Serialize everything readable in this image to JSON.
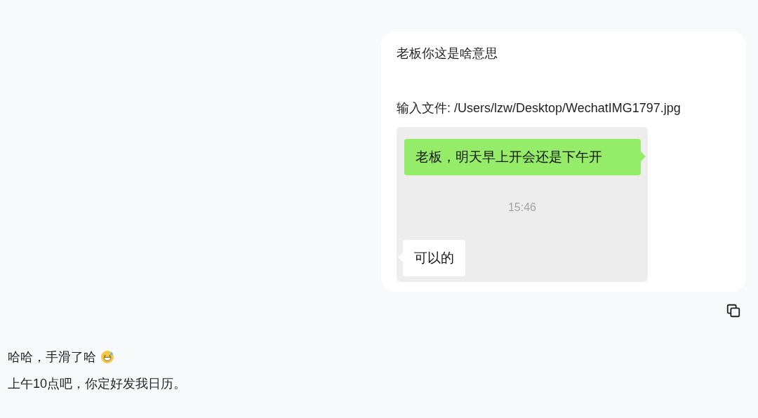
{
  "user_message": {
    "text": "老板你这是啥意思",
    "attachment_line": "输入文件: /Users/lzw/Desktop/WechatIMG1797.jpg",
    "attached_screenshot": {
      "messages": [
        {
          "kind": "sent",
          "text": "老板，明天早上开会还是下午开"
        },
        {
          "kind": "time",
          "text": "15:46"
        },
        {
          "kind": "received",
          "text": "可以的"
        }
      ]
    }
  },
  "reply": {
    "lines": [
      "哈哈，手滑了哈",
      "上午10点吧，你定好发我日历。"
    ]
  }
}
